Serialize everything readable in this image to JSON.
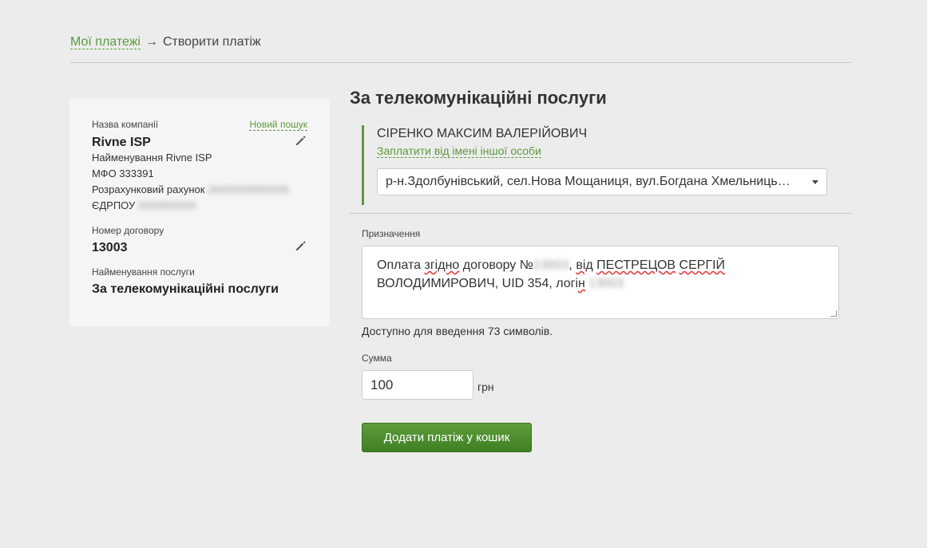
{
  "breadcrumb": {
    "parent": "Мої платежі",
    "arrow": "→",
    "current": "Створити платіж"
  },
  "company": {
    "label": "Назва компанії",
    "new_search": "Новий пошук",
    "name": "Rivne ISP",
    "full_name": "Найменування Rivne ISP",
    "mfo": "МФО 333391",
    "account_label": "Розрахунковий рахунок",
    "account_value": "26000000000000",
    "edrpou_label": "ЄДРПОУ",
    "edrpou_value": "0000000000"
  },
  "contract": {
    "label": "Номер договору",
    "number": "13003"
  },
  "service": {
    "label": "Найменування послуги",
    "name": "За телекомунікаційні послуги"
  },
  "main": {
    "title": "За телекомунікаційні послуги",
    "payer_name": "СІРЕНКО МАКСИМ ВАЛЕРІЙОВИЧ",
    "pay_other_link": "Заплатити від імені іншої особи",
    "address_selected": "р-н.Здолбунівський, сел.Нова Мощаниця, вул.Богдана Хмельницького"
  },
  "purpose": {
    "label": "Призначення",
    "text_part1": "Оплата",
    "text_word2": "згідно",
    "text_part3": "договору №",
    "blur1": "13003",
    "text_part4": ",",
    "text_word5": "від",
    "text_word6": "ПЕСТРЕЦОВ",
    "text_word7": "СЕРГІЙ",
    "text_part8": "ВОЛОДИМИРОВИЧ, UID 354, логі",
    "text_word9": "н",
    "blur2": "13003",
    "available": "Доступно для введення 73 символів."
  },
  "sum": {
    "label": "Сумма",
    "value": "100",
    "currency": "грн"
  },
  "add_button": "Додати платіж у кошик",
  "colors": {
    "accent": "#5c9a3d",
    "button": "#4a8a2c",
    "background": "#ececec"
  },
  "icons": {
    "edit": "pencil-icon",
    "dropdown": "caret-down-icon"
  }
}
